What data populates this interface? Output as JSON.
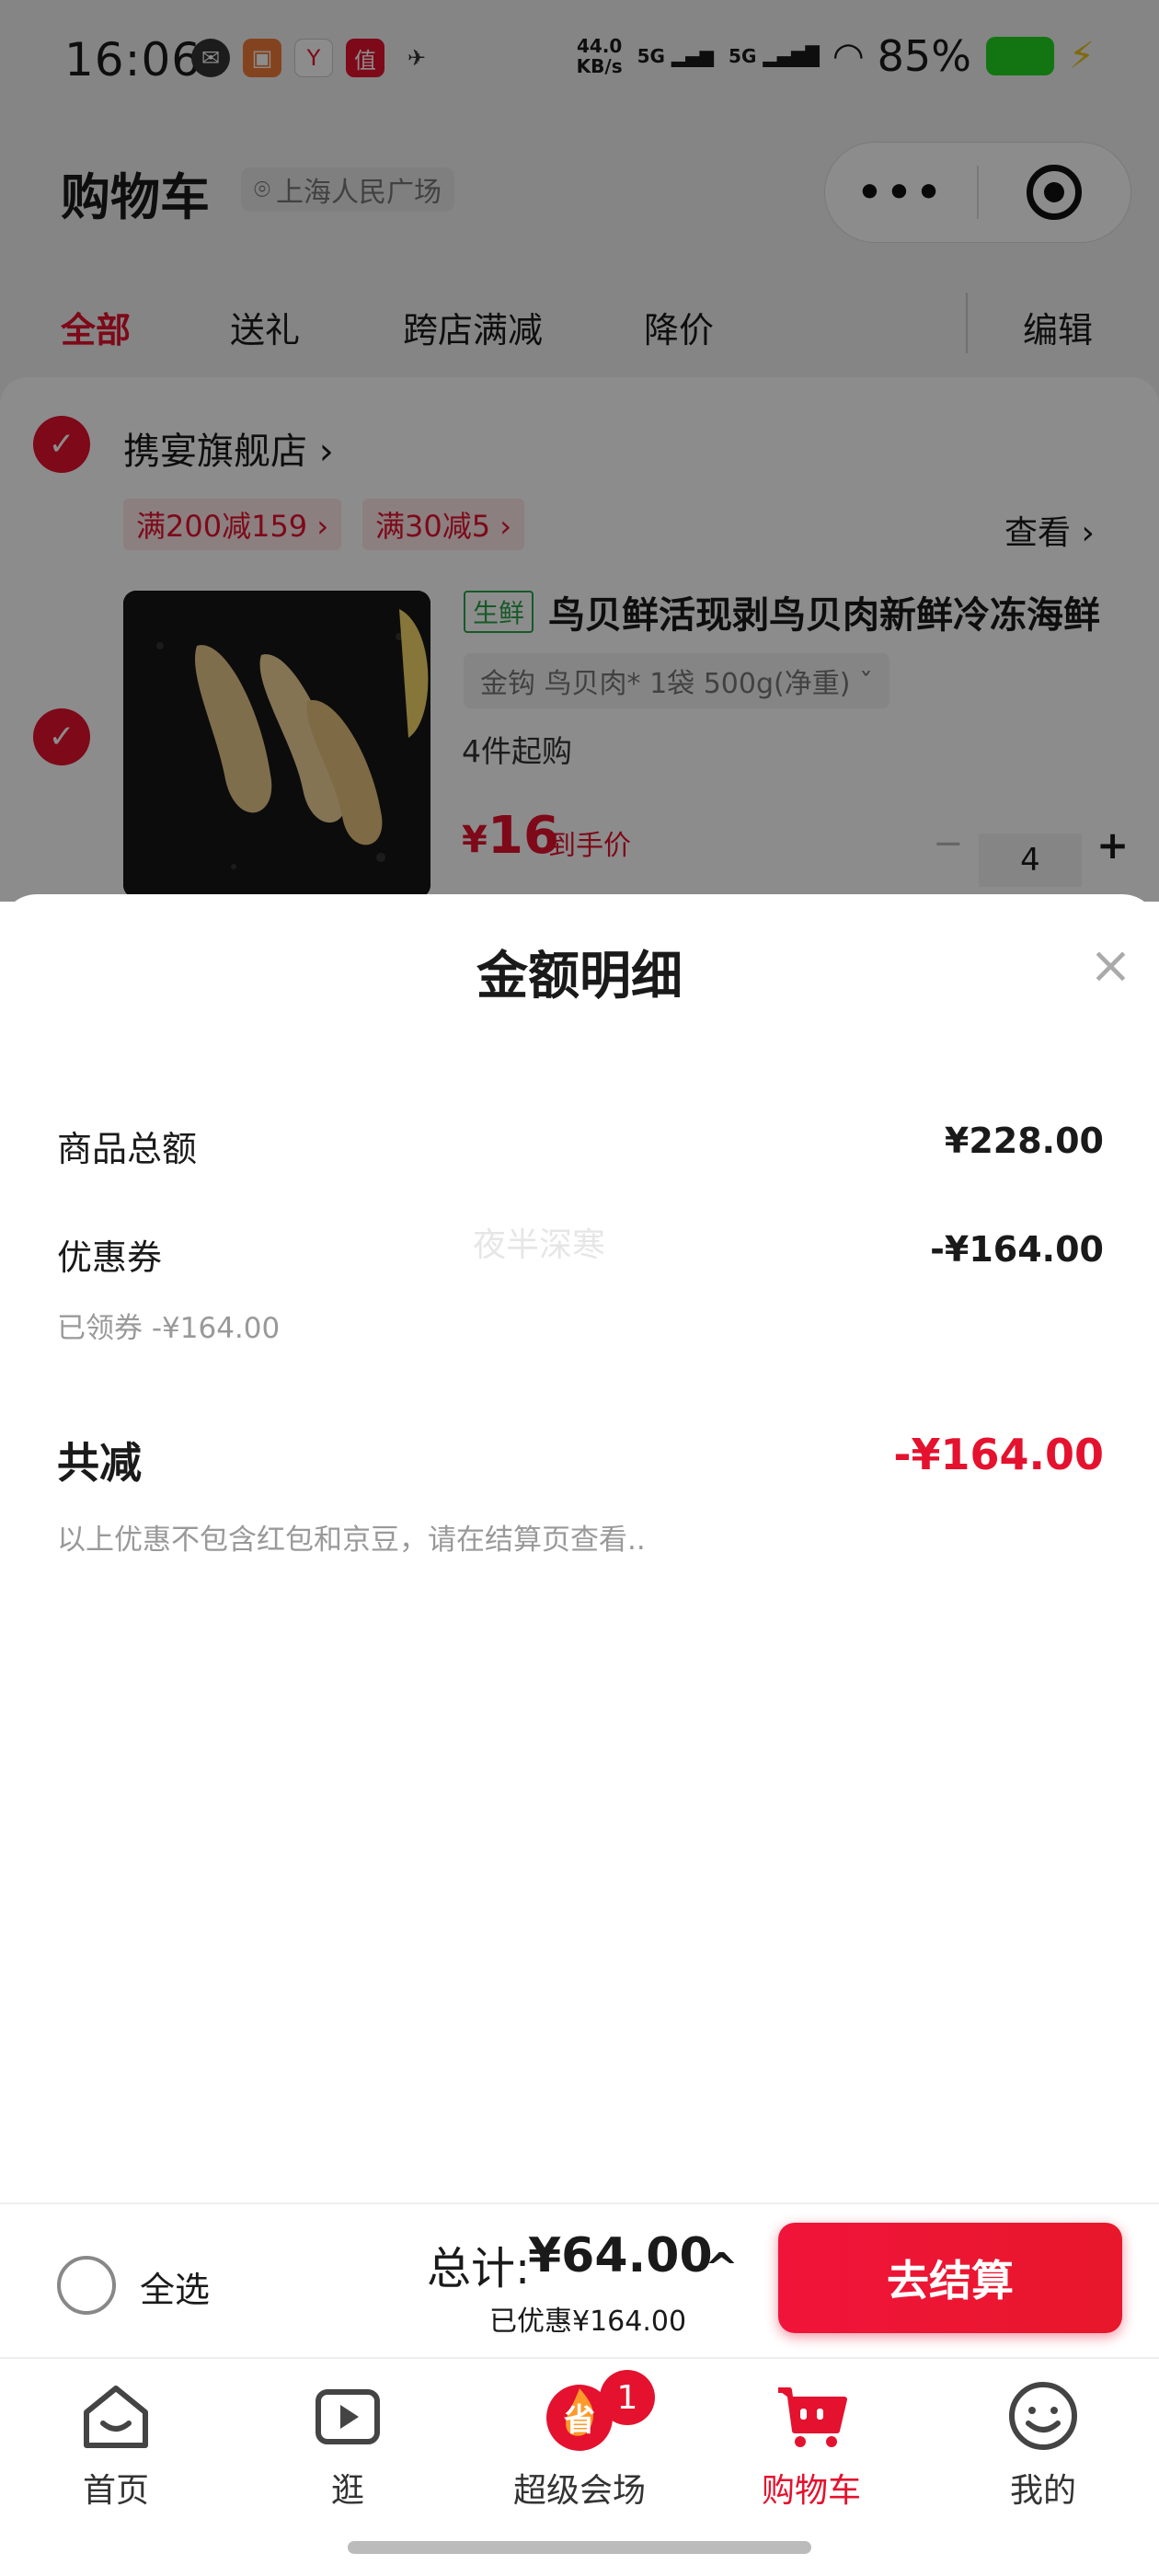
{
  "status_bar": {
    "time": "16:06",
    "speed_value": "44.0",
    "speed_unit": "KB/s",
    "signal_1": "5G",
    "signal_2": "5G",
    "battery_percent": "85%"
  },
  "header": {
    "title": "购物车",
    "location": "上海人民广场",
    "capsule_more": "•••"
  },
  "tabs": [
    {
      "label": "全部",
      "active": true
    },
    {
      "label": "送礼"
    },
    {
      "label": "跨店满减"
    },
    {
      "label": "降价"
    },
    {
      "label": "编辑"
    }
  ],
  "shop": {
    "name": "携宴旗舰店 ›",
    "promos": [
      "满200减159 ›",
      "满30减5 ›"
    ],
    "see_more": "查看 ›"
  },
  "product": {
    "tag": "生鲜",
    "title": "鸟贝鲜活现剥鸟贝肉新鲜冷冻海鲜",
    "spec": "金钩 鸟贝肉* 1袋 500g(净重)  ˇ",
    "min_buy": "4件起购",
    "price_symbol": "¥",
    "price": "16",
    "price_note": "到手价",
    "quantity": "4",
    "minus": "−",
    "plus": "+"
  },
  "sheet": {
    "title": "金额明细",
    "close": "×",
    "goods_total_label": "商品总额",
    "goods_total_value": "¥228.00",
    "coupon_label": "优惠券",
    "coupon_value": "-¥164.00",
    "coupon_sub": "已领券 -¥164.00",
    "watermark": "夜半深寒",
    "total_reduce_label": "共减",
    "total_reduce_value": "-¥164.00",
    "note": "以上优惠不包含红包和京豆，请在结算页查看.."
  },
  "checkout": {
    "select_all": "全选",
    "sum_label": "总计:",
    "sum_value": "¥64.00",
    "discount": "已优惠¥164.00",
    "expand": "^",
    "button": "去结算"
  },
  "nav": [
    {
      "label": "首页",
      "icon": "home-icon"
    },
    {
      "label": "逛",
      "icon": "video-icon"
    },
    {
      "label": "超级会场",
      "icon": "super-venue-icon",
      "badge": "1"
    },
    {
      "label": "购物车",
      "icon": "cart-icon",
      "active": true
    },
    {
      "label": "我的",
      "icon": "profile-icon"
    }
  ],
  "colors": {
    "accent": "#e4122e",
    "fresh_tag": "#2aa24a",
    "battery": "#22d522"
  }
}
